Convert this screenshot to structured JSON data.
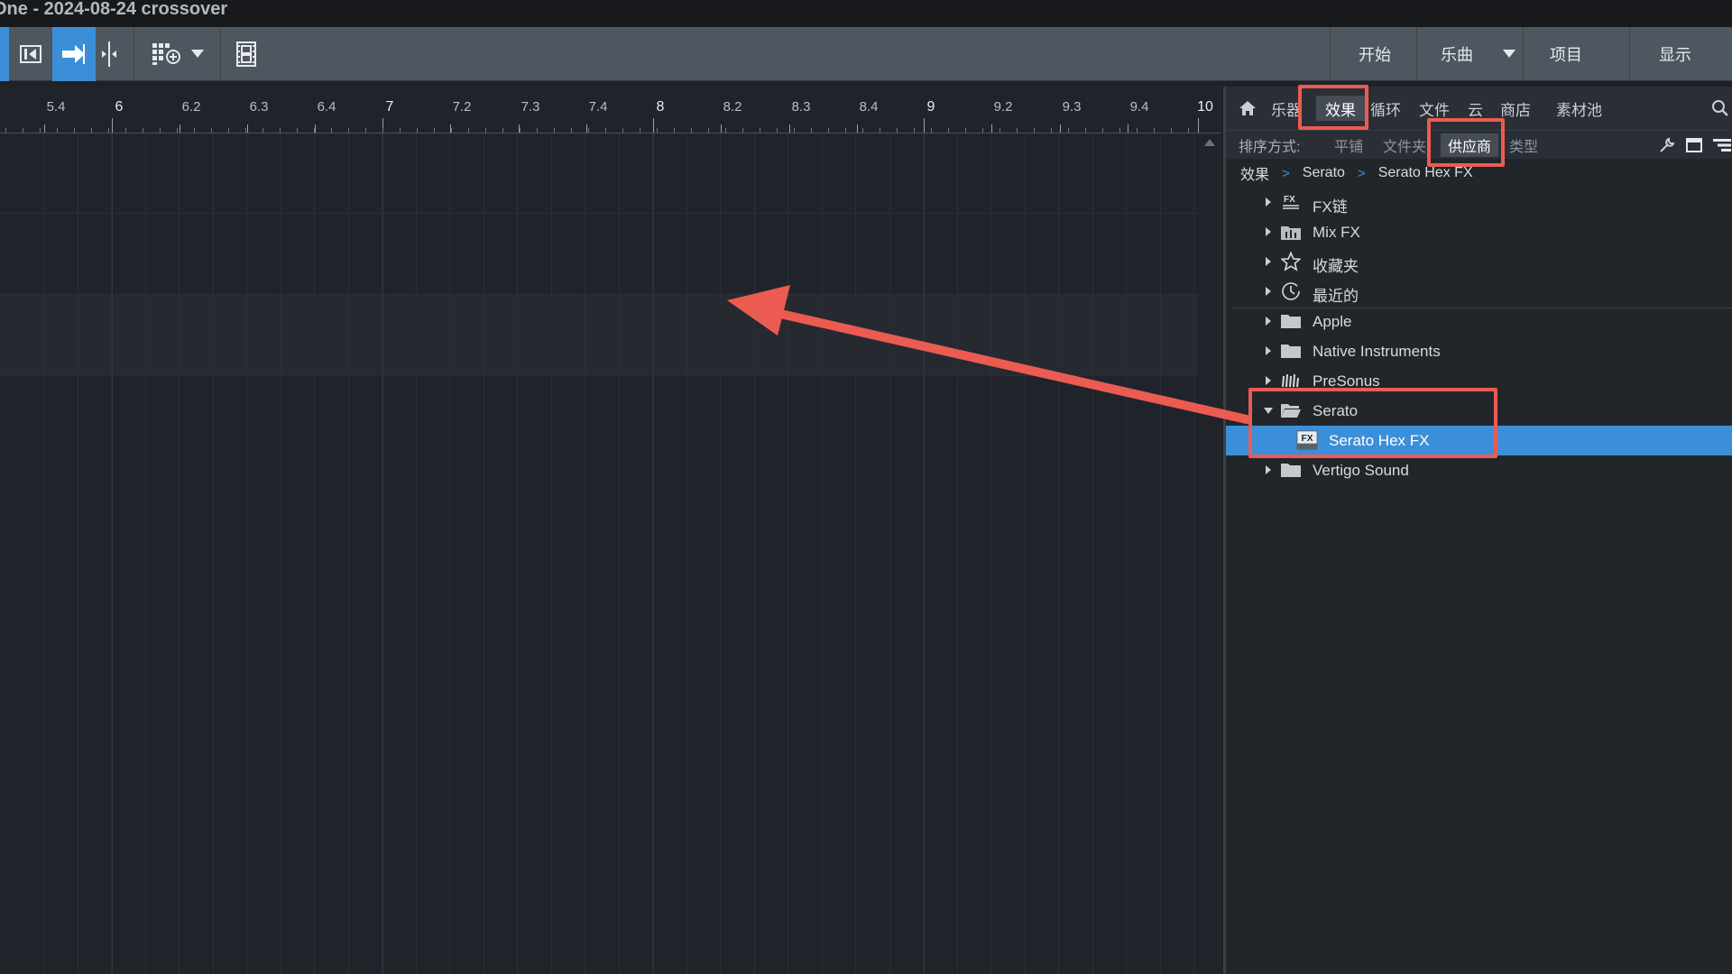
{
  "window": {
    "title": "One - 2024-08-24 crossover"
  },
  "toolbar": {
    "nav": [
      "开始",
      "乐曲",
      "项目",
      "显示"
    ]
  },
  "ruler": {
    "labels": [
      "5.4",
      "6",
      "6.2",
      "6.3",
      "6.4",
      "7",
      "7.2",
      "7.3",
      "7.4",
      "8",
      "8.2",
      "8.3",
      "8.4",
      "9",
      "9.2",
      "9.3",
      "9.4",
      "10"
    ]
  },
  "browser": {
    "tabs": [
      "乐器",
      "效果",
      "循环",
      "文件",
      "云",
      "商店",
      "素材池"
    ],
    "sort_label": "排序方式:",
    "sort_options": [
      "平铺",
      "文件夹",
      "供应商",
      "类型"
    ],
    "breadcrumb": [
      "效果",
      "Serato",
      "Serato Hex FX"
    ],
    "tree": [
      {
        "label": "FX链",
        "icon": "fx-chain-icon"
      },
      {
        "label": "Mix FX",
        "icon": "mix-fx-icon"
      },
      {
        "label": "收藏夹",
        "icon": "star-icon"
      },
      {
        "label": "最近的",
        "icon": "clock-icon"
      },
      {
        "label": "Apple",
        "icon": "folder-icon"
      },
      {
        "label": "Native Instruments",
        "icon": "folder-icon"
      },
      {
        "label": "PreSonus",
        "icon": "presonus-icon"
      },
      {
        "label": "Serato",
        "icon": "folder-open-icon"
      },
      {
        "label": "Serato Hex FX",
        "icon": "fx-plugin-icon"
      },
      {
        "label": "Vertigo Sound",
        "icon": "folder-icon"
      }
    ],
    "plugin_badge": "FX"
  },
  "colors": {
    "accent": "#3b8fd9",
    "annotation": "#ec5b52"
  }
}
